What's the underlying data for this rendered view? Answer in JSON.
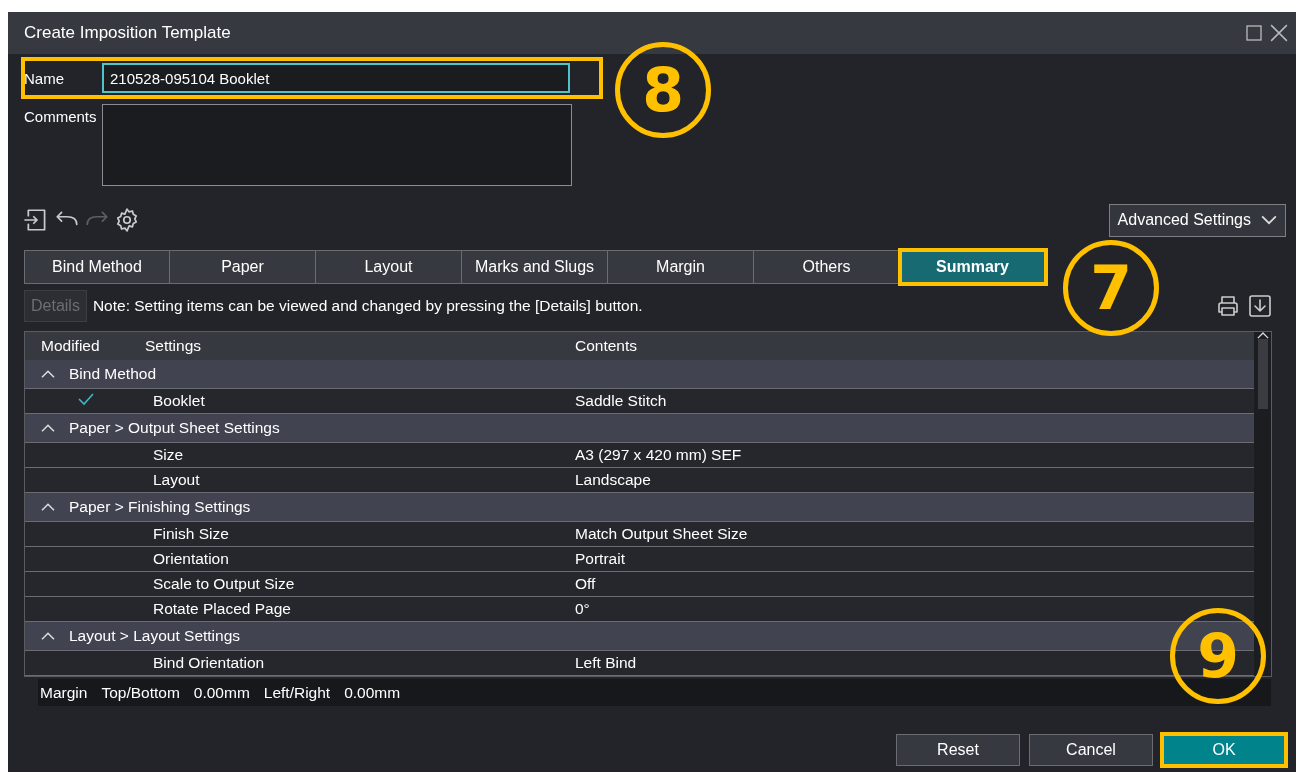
{
  "window": {
    "title": "Create Imposition Template",
    "controls": [
      {
        "kind": "maximize"
      },
      {
        "kind": "close"
      }
    ]
  },
  "name_field": {
    "label": "Name",
    "value": "210528-095104 Booklet",
    "highlighted": true
  },
  "comments_field": {
    "label": "Comments"
  },
  "toolbar": [
    {
      "kind": "import",
      "disabled": false
    },
    {
      "kind": "undo",
      "disabled": false
    },
    {
      "kind": "redo",
      "disabled": true
    },
    {
      "kind": "settings",
      "disabled": false
    }
  ],
  "advanced_settings": {
    "label": "Advanced Settings"
  },
  "tabs": [
    {
      "label": "Bind Method",
      "selected": false,
      "highlighted": false
    },
    {
      "label": "Paper",
      "selected": false,
      "highlighted": false
    },
    {
      "label": "Layout",
      "selected": false,
      "highlighted": false
    },
    {
      "label": "Marks and Slugs",
      "selected": false,
      "highlighted": false
    },
    {
      "label": "Margin",
      "selected": false,
      "highlighted": false
    },
    {
      "label": "Others",
      "selected": false,
      "highlighted": false
    },
    {
      "label": "Summary",
      "selected": true,
      "highlighted": true
    }
  ],
  "details_button": {
    "label": "Details",
    "disabled": true
  },
  "note": "Note: Setting items can be viewed and changed by pressing the [Details] button.",
  "table": {
    "columns": [
      "Modified",
      "Settings",
      "Contents"
    ],
    "groups": [
      {
        "title": "Bind Method",
        "expanded": true,
        "rows": [
          {
            "modified": true,
            "setting": "Booklet",
            "content": "Saddle Stitch"
          }
        ]
      },
      {
        "title": "Paper > Output Sheet Settings",
        "expanded": true,
        "rows": [
          {
            "modified": false,
            "setting": "Size",
            "content": "A3 (297 x 420 mm) SEF"
          },
          {
            "modified": false,
            "setting": "Layout",
            "content": "Landscape"
          }
        ]
      },
      {
        "title": "Paper > Finishing Settings",
        "expanded": true,
        "rows": [
          {
            "modified": false,
            "setting": "Finish Size",
            "content": "Match Output Sheet Size"
          },
          {
            "modified": false,
            "setting": "Orientation",
            "content": "Portrait"
          },
          {
            "modified": false,
            "setting": "Scale to Output Size",
            "content": "Off"
          },
          {
            "modified": false,
            "setting": "Rotate Placed Page",
            "content": "0°"
          }
        ]
      },
      {
        "title": "Layout > Layout Settings",
        "expanded": true,
        "rows": [
          {
            "modified": false,
            "setting": "Bind Orientation",
            "content": "Left Bind"
          }
        ]
      }
    ]
  },
  "margin_bar": [
    "Margin",
    "Top/Bottom",
    "0.00mm",
    "Left/Right",
    "0.00mm"
  ],
  "buttons": [
    {
      "label": "Reset",
      "kind": "secondary",
      "highlighted": false
    },
    {
      "label": "Cancel",
      "kind": "secondary",
      "highlighted": false
    },
    {
      "label": "OK",
      "kind": "primary",
      "highlighted": true
    }
  ],
  "annotations": [
    {
      "label": "8",
      "kind": "name"
    },
    {
      "label": "7",
      "kind": "tabs"
    },
    {
      "label": "9",
      "kind": "buttons"
    }
  ]
}
